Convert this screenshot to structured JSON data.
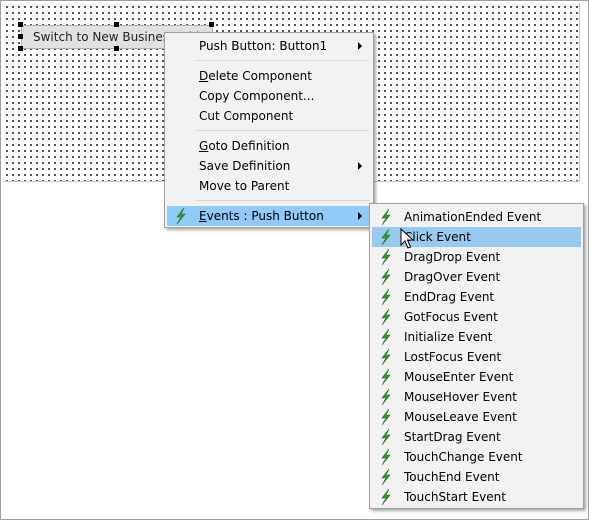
{
  "designer": {
    "button_text": "Switch to New Business Object"
  },
  "context_menu": {
    "items": [
      {
        "label": "Push Button: Button1",
        "submenu": true
      },
      {
        "label_ul": "D",
        "label_rest": "elete Component"
      },
      {
        "label": "Copy Component..."
      },
      {
        "label": "Cut Component"
      },
      {
        "label_ul": "G",
        "label_rest": "oto Definition"
      },
      {
        "label": "Save Definition",
        "submenu": true
      },
      {
        "label": "Move to Parent"
      },
      {
        "label_ul": "E",
        "label_rest": "vents : Push Button",
        "submenu": true
      }
    ]
  },
  "events_submenu": {
    "items": [
      "AnimationEnded Event",
      "Click Event",
      "DragDrop Event",
      "DragOver Event",
      "EndDrag Event",
      "GotFocus Event",
      "Initialize Event",
      "LostFocus Event",
      "MouseEnter Event",
      "MouseHover Event",
      "MouseLeave Event",
      "StartDrag Event",
      "TouchChange Event",
      "TouchEnd Event",
      "TouchStart Event"
    ],
    "selected_index": 1
  },
  "icons": {
    "event": "lightning-bolt-icon",
    "submenu_arrow": "chevron-right-icon",
    "pointer": "mouse-cursor-icon"
  },
  "colors": {
    "highlight": "#99c9ef",
    "bolt_green": "#2e9d2e"
  }
}
